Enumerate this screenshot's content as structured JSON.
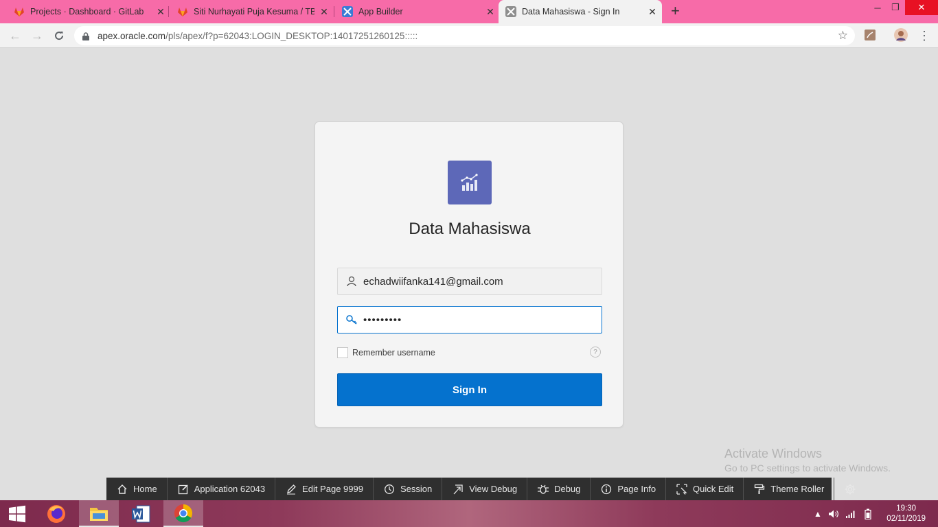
{
  "browser": {
    "tabs": [
      {
        "title": "Projects · Dashboard · GitLab",
        "icon": "gitlab-icon"
      },
      {
        "title": "Siti Nurhayati Puja Kesuma / TB D",
        "icon": "gitlab-icon"
      },
      {
        "title": "App Builder",
        "icon": "apex-icon"
      },
      {
        "title": "Data Mahasiswa - Sign In",
        "icon": "apex-icon",
        "active": true
      }
    ],
    "url_host": "apex.oracle.com",
    "url_path": "/pls/apex/f?p=62043:LOGIN_DESKTOP:14017251260125:::::",
    "tab_strip_color": "#f76ba8"
  },
  "login": {
    "app_title": "Data Mahasiswa",
    "username": "echadwiifanka141@gmail.com",
    "password_mask": "•••••••••",
    "remember_label": "Remember username",
    "help_glyph": "?",
    "signin_label": "Sign In",
    "accent_color": "#0572ce",
    "icon_color": "#5d68b8"
  },
  "watermark": {
    "line1": "Activate Windows",
    "line2": "Go to PC settings to activate Windows."
  },
  "devbar": {
    "items": [
      {
        "label": "Home",
        "icon": "home-icon"
      },
      {
        "label": "Application 62043",
        "icon": "edit-app-icon"
      },
      {
        "label": "Edit Page 9999",
        "icon": "pencil-icon"
      },
      {
        "label": "Session",
        "icon": "clock-icon"
      },
      {
        "label": "View Debug",
        "icon": "view-debug-icon"
      },
      {
        "label": "Debug",
        "icon": "bug-icon"
      },
      {
        "label": "Page Info",
        "icon": "info-icon"
      },
      {
        "label": "Quick Edit",
        "icon": "quick-edit-icon"
      },
      {
        "label": "Theme Roller",
        "icon": "paint-roller-icon"
      }
    ]
  },
  "taskbar": {
    "time": "19:30",
    "date": "02/11/2019"
  }
}
